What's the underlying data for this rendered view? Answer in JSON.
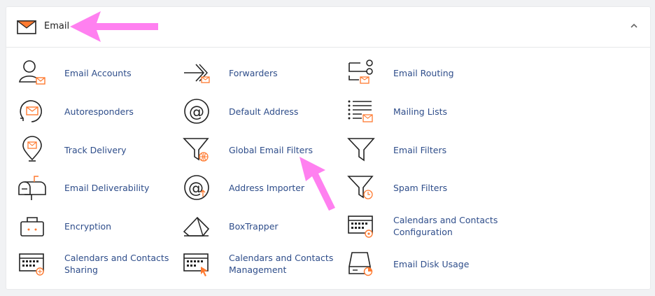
{
  "section": {
    "title": "Email",
    "icon": "envelope-icon",
    "collapse_icon": "chevron-up-icon"
  },
  "items": [
    {
      "label": "Email Accounts",
      "icon": "user-envelope-icon"
    },
    {
      "label": "Forwarders",
      "icon": "forward-arrow-icon"
    },
    {
      "label": "Email Routing",
      "icon": "routing-icon"
    },
    {
      "label": "Autoresponders",
      "icon": "autoresponder-icon"
    },
    {
      "label": "Default Address",
      "icon": "at-sign-icon"
    },
    {
      "label": "Mailing Lists",
      "icon": "list-envelope-icon"
    },
    {
      "label": "Track Delivery",
      "icon": "location-pin-icon"
    },
    {
      "label": "Global Email Filters",
      "icon": "filter-globe-icon"
    },
    {
      "label": "Email Filters",
      "icon": "filter-icon"
    },
    {
      "label": "Email Deliverability",
      "icon": "mailbox-icon"
    },
    {
      "label": "Address Importer",
      "icon": "at-import-icon"
    },
    {
      "label": "Spam Filters",
      "icon": "filter-clock-icon"
    },
    {
      "label": "Encryption",
      "icon": "lock-key-icon"
    },
    {
      "label": "BoxTrapper",
      "icon": "box-trapper-icon"
    },
    {
      "label": "Calendars and Contacts Configuration",
      "icon": "calendar-gear-icon"
    },
    {
      "label": "Calendars and Contacts Sharing",
      "icon": "calendar-share-icon"
    },
    {
      "label": "Calendars and Contacts Management",
      "icon": "calendar-cursor-icon"
    },
    {
      "label": "Email Disk Usage",
      "icon": "disk-usage-icon"
    }
  ],
  "colors": {
    "accent_orange": "#ff7a30",
    "link_blue": "#2e4d8a",
    "annotation_pink": "#ff80f0"
  }
}
